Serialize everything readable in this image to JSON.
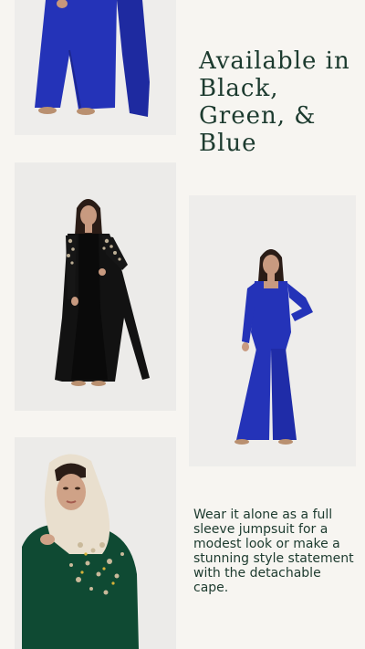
{
  "headline": {
    "line1": "Available in",
    "line2": "Black,",
    "line3": "Green, &",
    "line4": "Blue"
  },
  "description": "Wear it alone as a full sleeve jumpsuit for a modest look or make a stunning style statement with the detachable cape.",
  "colors": {
    "background": "#f7f5f1",
    "text": "#1c3a2e",
    "blue": "#2433b8",
    "black": "#111111",
    "green": "#0f4a33"
  }
}
